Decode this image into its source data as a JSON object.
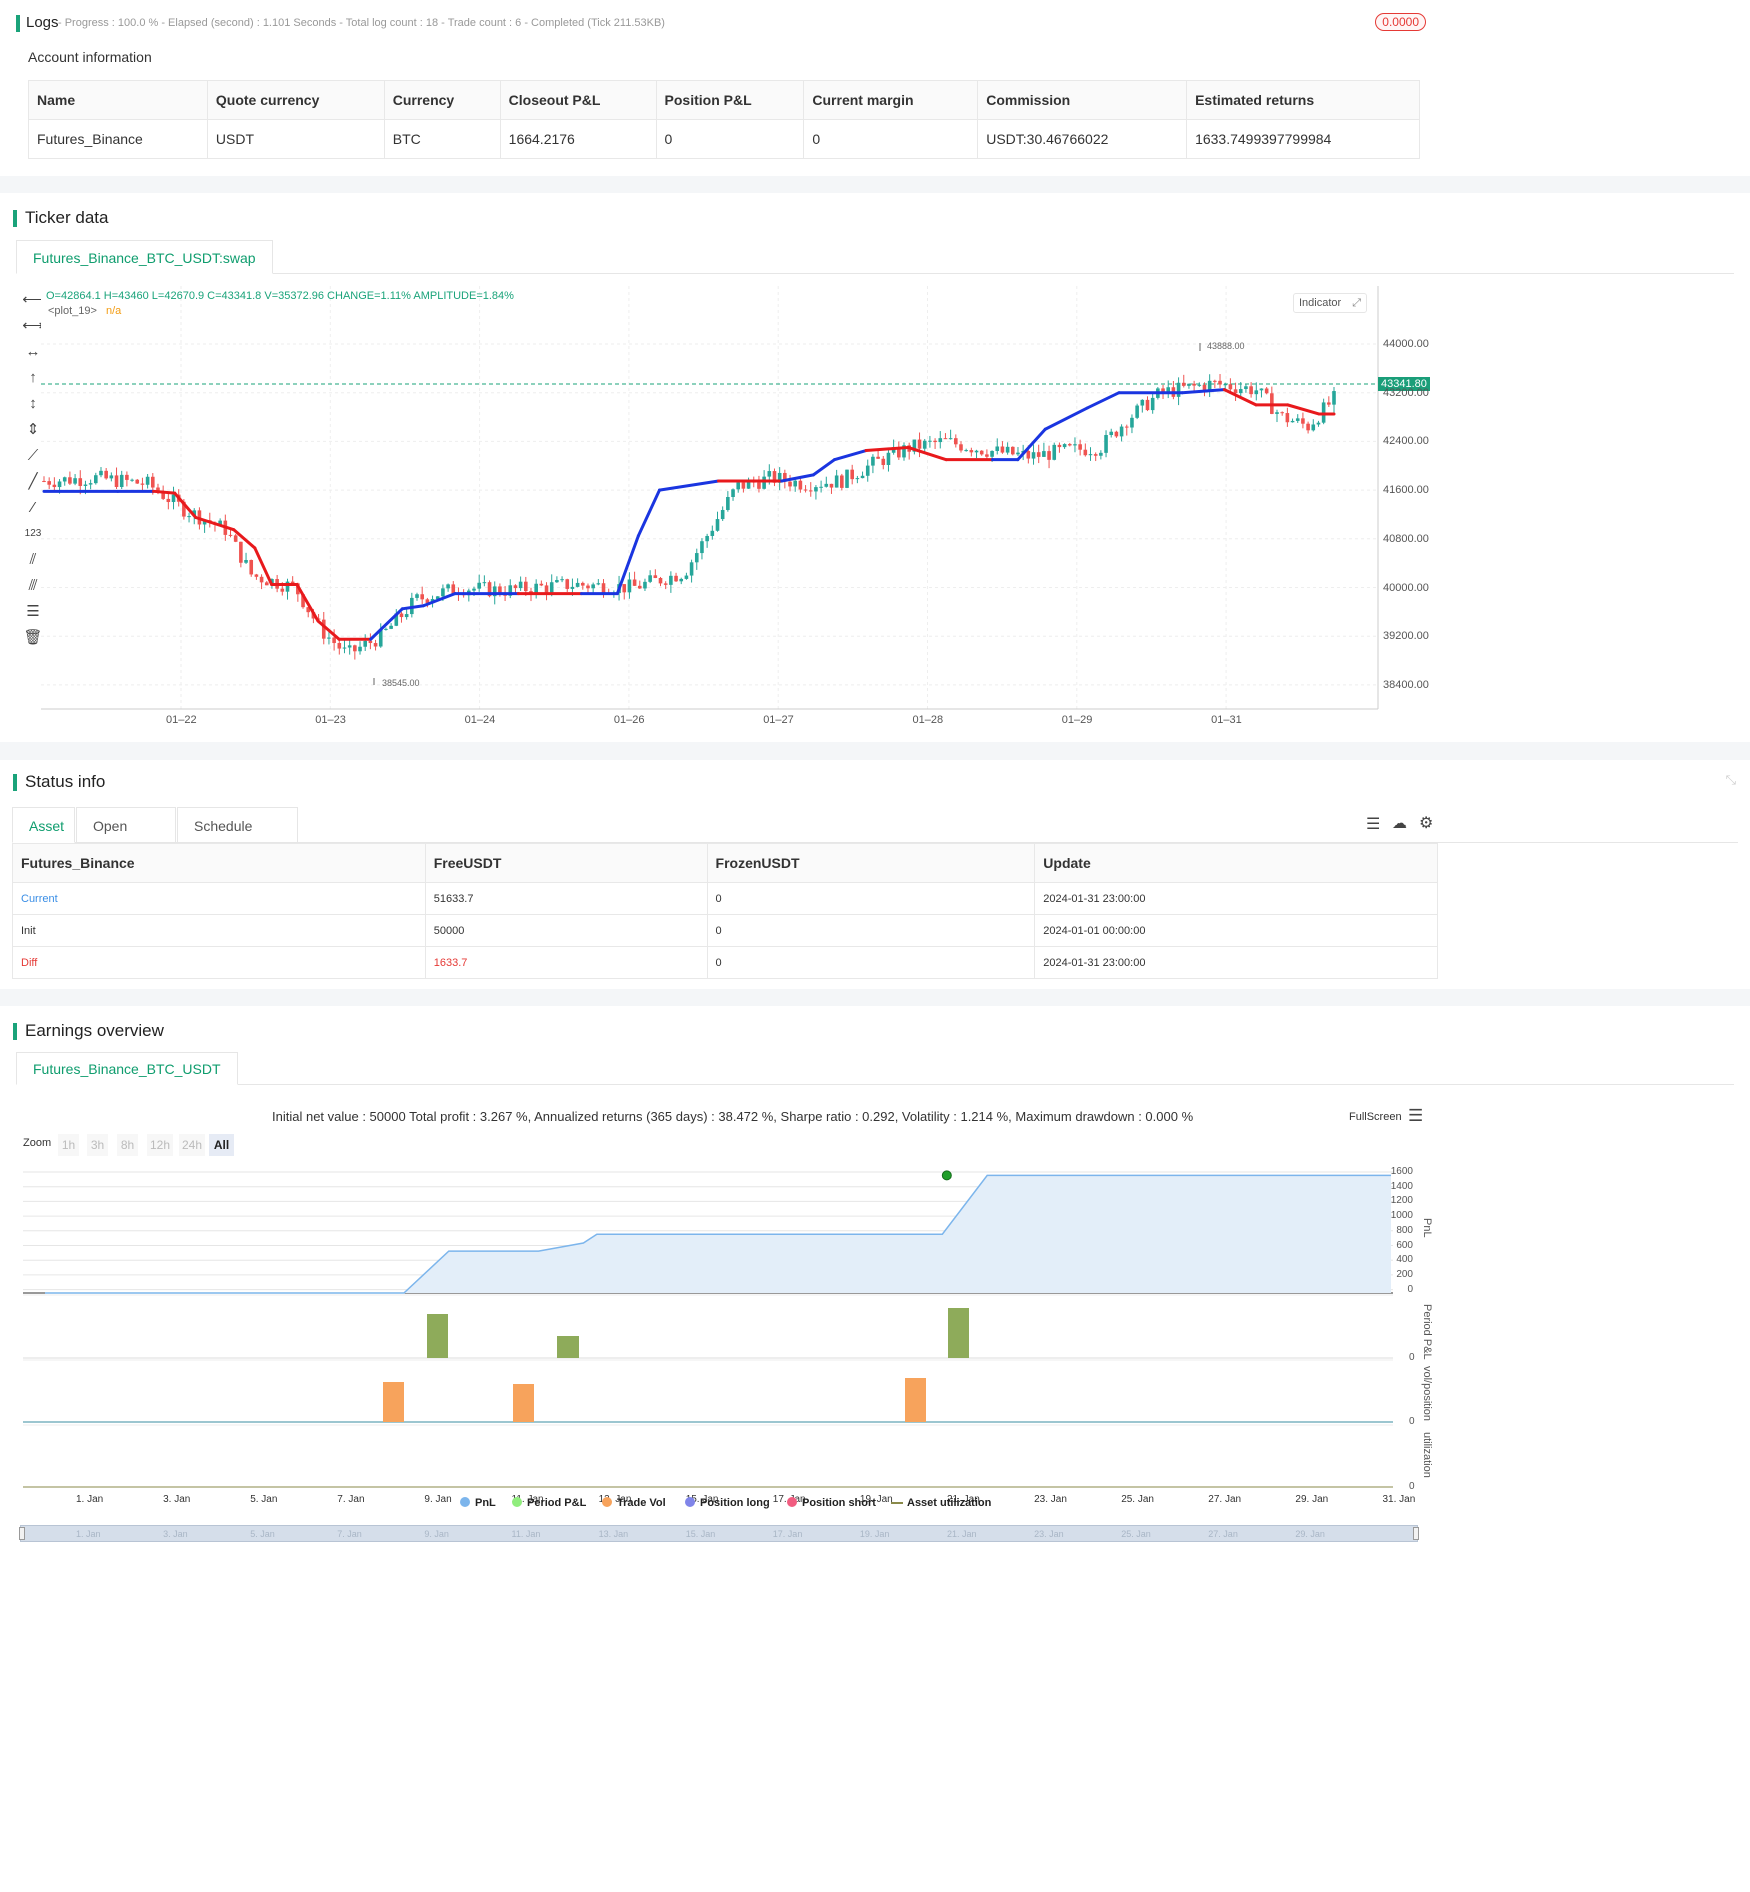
{
  "logs": {
    "title": "Logs",
    "summary": "- Progress : 100.0 % - Elapsed (second) : 1.101  Seconds - Total log count : 18 - Trade count : 6 - Completed (Tick 211.53KB)",
    "badge": "0.0000"
  },
  "account": {
    "title": "Account information",
    "headers": [
      "Name",
      "Quote currency",
      "Currency",
      "Closeout P&L",
      "Position P&L",
      "Current margin",
      "Commission",
      "Estimated returns"
    ],
    "row": [
      "Futures_Binance",
      "USDT",
      "BTC",
      "1664.2176",
      "0",
      "0",
      "USDT:30.46766022",
      "1633.7499397799984"
    ]
  },
  "ticker": {
    "title": "Ticker data",
    "tab": "Futures_Binance_BTC_USDT:swap",
    "ohlc": "O=42864.1 H=43460 L=42670.9 C=43341.8 V=35372.96 CHANGE=1.11% AMPLITUDE=1.84%",
    "plot_label": "<plot_19>",
    "plot_value": "n/a",
    "indicator_btn": "Indicator",
    "price_tag": "43341.80",
    "high_mark": "43888.00",
    "low_mark": "38545.00",
    "y_ticks": [
      "44000.00",
      "43200.00",
      "42400.00",
      "41600.00",
      "40800.00",
      "40000.00",
      "39200.00",
      "38400.00"
    ],
    "x_ticks": [
      "01–22",
      "01–23",
      "01–24",
      "01–26",
      "01–27",
      "01–28",
      "01–29",
      "01–31"
    ]
  },
  "status": {
    "title": "Status info",
    "tabs": [
      "Asset",
      "Open orders",
      "Schedule orders"
    ],
    "headers": [
      "Futures_Binance",
      "FreeUSDT",
      "FrozenUSDT",
      "Update"
    ],
    "rows": [
      [
        "Current",
        "51633.7",
        "0",
        "2024-01-31 23:00:00"
      ],
      [
        "Init",
        "50000",
        "0",
        "2024-01-01 00:00:00"
      ],
      [
        "Diff",
        "1633.7",
        "0",
        "2024-01-31 23:00:00"
      ]
    ]
  },
  "earnings": {
    "title": "Earnings overview",
    "tab": "Futures_Binance_BTC_USDT",
    "summary": "Initial net value : 50000 Total profit : 3.267 %, Annualized returns (365 days) : 38.472 %, Sharpe ratio : 0.292, Volatility : 1.214 %, Maximum drawdown : 0.000 %",
    "fullscreen": "FullScreen",
    "zoom_label": "Zoom",
    "zoom_buttons": [
      "1h",
      "3h",
      "8h",
      "12h",
      "24h",
      "All"
    ],
    "pnl_ticks": [
      "1600",
      "1400",
      "1200",
      "1000",
      "800",
      "600",
      "400",
      "200",
      "0"
    ],
    "axis_labels": [
      "PnL",
      "Period P&L",
      "vol/position",
      "utilization"
    ],
    "zero": "0",
    "x_ticks": [
      "1. Jan",
      "3. Jan",
      "5. Jan",
      "7. Jan",
      "9. Jan",
      "11. Jan",
      "13. Jan",
      "15. Jan",
      "17. Jan",
      "19. Jan",
      "21. Jan",
      "23. Jan",
      "25. Jan",
      "27. Jan",
      "29. Jan",
      "31. Jan"
    ],
    "legend": [
      "PnL",
      "Period P&L",
      "Trade Vol",
      "Position long",
      "Position short",
      "Asset utilization"
    ],
    "legend_colors": [
      "#7cb5ec",
      "#90ed7d",
      "#f7a35c",
      "#8085e9",
      "#f15c80",
      "#8a8a4a"
    ]
  },
  "chart_data": {
    "type": "line",
    "title": "",
    "x": [
      "1. Jan",
      "9. Jan",
      "12. Jan",
      "13. Jan",
      "20. Jan",
      "21. Jan",
      "31. Jan"
    ],
    "series": [
      {
        "name": "PnL",
        "values": [
          0,
          0,
          570,
          570,
          900,
          1600,
          1600
        ]
      }
    ],
    "bars": {
      "period_pnl": [
        {
          "x": "9. Jan",
          "value": 570
        },
        {
          "x": "12. Jan",
          "value": 300
        },
        {
          "x": "21. Jan",
          "value": 700
        }
      ],
      "trade_vol": [
        {
          "x": "8. Jan",
          "value": 1
        },
        {
          "x": "11. Jan",
          "value": 1
        },
        {
          "x": "20. Jan",
          "value": 1
        }
      ]
    },
    "ylim": [
      0,
      1600
    ]
  }
}
